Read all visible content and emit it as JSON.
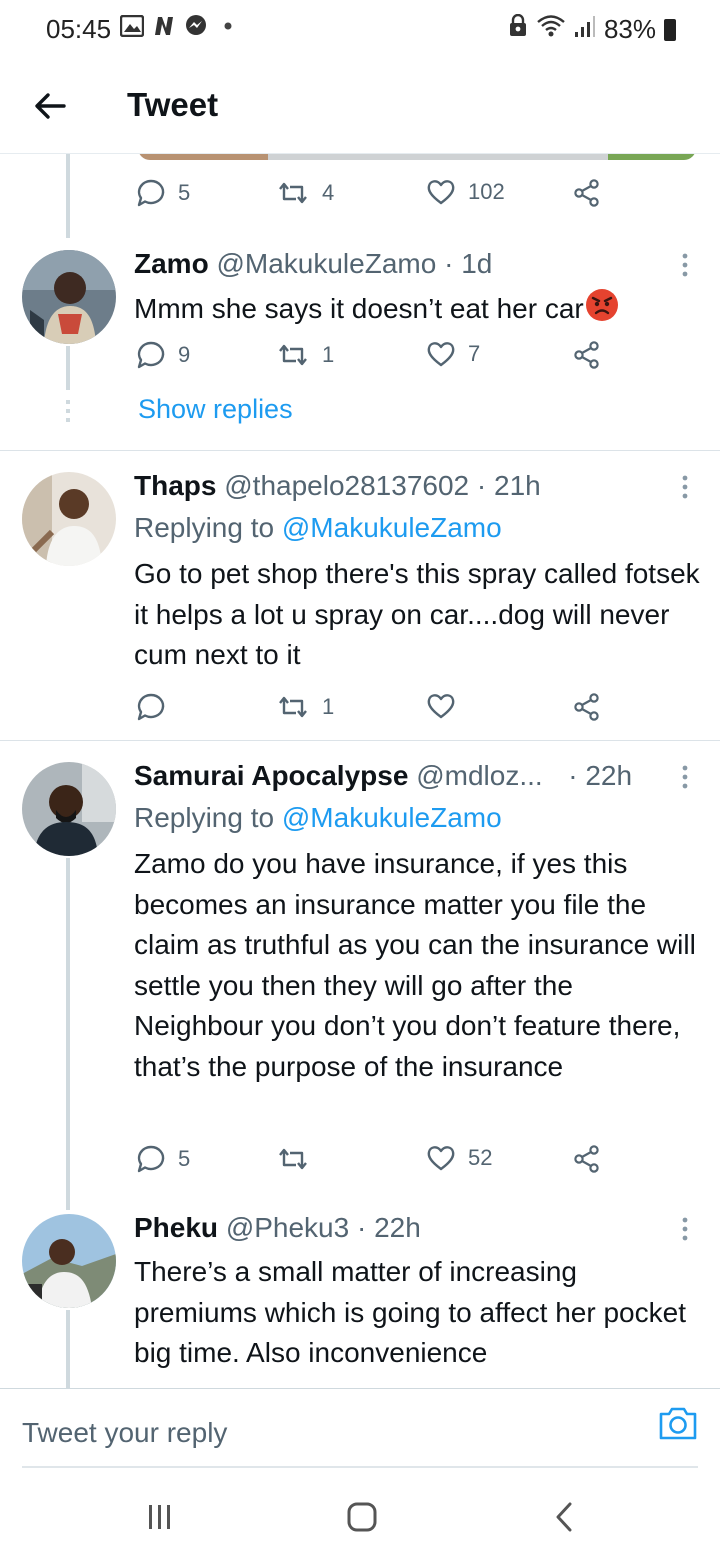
{
  "status_bar": {
    "time": "05:45",
    "left_icons": [
      "gallery-icon",
      "n-app-icon",
      "messenger-icon",
      "dot-icon"
    ],
    "right_icons": [
      "lock-icon",
      "wifi-icon",
      "signal-icon"
    ],
    "battery": "83%"
  },
  "header": {
    "title": "Tweet",
    "back_icon": "arrow-left-icon"
  },
  "top_tweet_actions": {
    "replies": "5",
    "retweets": "4",
    "likes": "102"
  },
  "tweets": [
    {
      "name": "Zamo",
      "handle": "@MakukuleZamo",
      "sep": " · ",
      "time": "1d",
      "reply_to_label": "",
      "reply_to": "",
      "text": "Mmm she says it doesn’t eat her car",
      "emoji": "angry-face-icon",
      "replies": "9",
      "retweets": "1",
      "likes": "7",
      "show_replies": "Show replies"
    },
    {
      "name": "Thaps",
      "handle": "@thapelo28137602",
      "sep": " · ",
      "time": "21h",
      "reply_to_label": "Replying to ",
      "reply_to": "@MakukuleZamo",
      "text": "Go to pet shop there's this spray called fotsek it helps a lot u spray on car....dog will never cum next to it",
      "replies": "",
      "retweets": "1",
      "likes": ""
    },
    {
      "name": "Samurai Apocalypse",
      "handle": "@mdloz...",
      "sep": " · ",
      "time": "22h",
      "reply_to_label": "Replying to ",
      "reply_to": "@MakukuleZamo",
      "text": "Zamo do you have insurance, if yes this becomes an insurance matter you file the claim as truthful as you can the insurance will settle you then they will go after the Neighbour you don’t you don’t feature there, that’s the purpose of the insurance",
      "replies": "5",
      "retweets": "",
      "likes": "52"
    },
    {
      "name": "Pheku",
      "handle": "@Pheku3",
      "sep": " · ",
      "time": "22h",
      "reply_to_label": "",
      "reply_to": "",
      "text": "There’s a small matter of increasing premiums which is going to affect her pocket big time. Also inconvenience"
    }
  ],
  "reply_bar": {
    "placeholder": "Tweet your reply",
    "camera_icon": "camera-icon"
  },
  "nav_bar": {
    "buttons": [
      "recent-apps-icon",
      "home-icon",
      "back-icon"
    ]
  },
  "colors": {
    "accent": "#1d9bf0",
    "muted": "#536471",
    "text": "#0f1419",
    "divider": "#dce3e8",
    "emoji": "#e5432f"
  }
}
